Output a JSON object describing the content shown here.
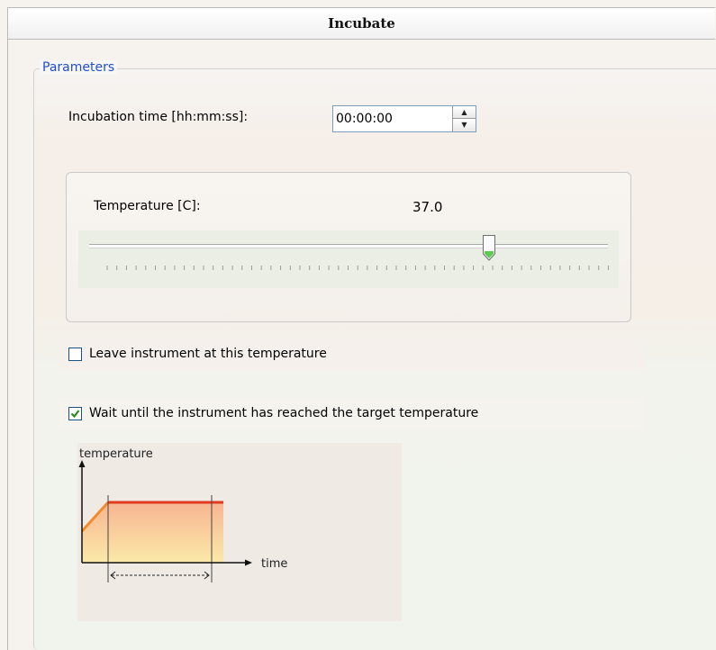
{
  "panel": {
    "title": "Incubate"
  },
  "parameters": {
    "legend": "Parameters",
    "incubation_time": {
      "label": "Incubation time [hh:mm:ss]:",
      "value": "00:00:00",
      "spin_up_icon": "triangle-up",
      "spin_down_icon": "triangle-down"
    },
    "temperature": {
      "label": "Temperature [C]:",
      "value": "37.0",
      "slider_position_fraction": 0.77
    },
    "leave_at_temperature": {
      "label": "Leave instrument at this temperature",
      "checked": false
    },
    "wait_until_reached": {
      "label": "Wait until the instrument has reached the target temperature",
      "checked": true
    }
  },
  "diagram": {
    "y_axis_label": "temperature",
    "x_axis_label": "time",
    "colors": {
      "line": "#e23b1f",
      "fill_top": "#f7b592",
      "fill_bottom": "#fbe9a8",
      "check": "#2a8a1a",
      "accent": "#1f4fd0"
    }
  }
}
